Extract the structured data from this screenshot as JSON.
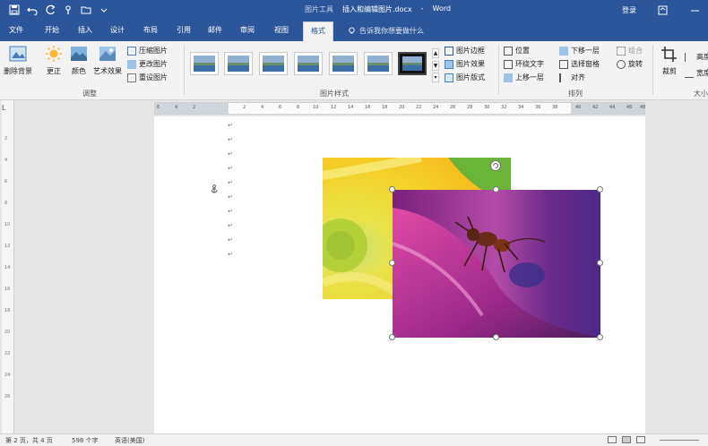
{
  "title": {
    "context": "图片工具",
    "document": "插入和编辑图片.docx",
    "app": "Word",
    "login": "登录"
  },
  "tabs": [
    "文件",
    "开始",
    "插入",
    "设计",
    "布局",
    "引用",
    "邮件",
    "审阅",
    "视图",
    "格式"
  ],
  "active_tab": "格式",
  "tell_me": "告诉我你想要做什么",
  "ribbon": {
    "adjust": {
      "label": "调整",
      "remove_bg": "删除背景",
      "corrections": "更正",
      "color": "颜色",
      "artistic": "艺术效果",
      "compress": "压缩图片",
      "change": "更改图片",
      "reset": "重设图片"
    },
    "styles": {
      "label": "图片样式",
      "border": "图片边框",
      "effects": "图片效果",
      "layout": "图片版式"
    },
    "arrange": {
      "label": "排列",
      "position": "位置",
      "wrap": "环绕文字",
      "forward": "上移一层",
      "backward": "下移一层",
      "selection": "选择窗格",
      "align": "对齐",
      "group": "组合",
      "rotate": "旋转"
    },
    "size": {
      "crop": "裁剪",
      "label": "大小",
      "height": "高度",
      "width": "宽度"
    }
  },
  "ruler": {
    "h_numbers": [
      "6",
      "4",
      "2",
      "",
      "2",
      "4",
      "6",
      "8",
      "10",
      "12",
      "14",
      "16",
      "18",
      "20",
      "22",
      "24",
      "26",
      "28",
      "30",
      "32",
      "34",
      "36",
      "38",
      "40",
      "42",
      "44",
      "46",
      "48"
    ],
    "corner": "L"
  },
  "status": {
    "page": "第 2 页，共 4 页",
    "words": "598 个字",
    "language": "英语(美国)"
  },
  "colors": {
    "titlebar": "#2b579a",
    "ribbon": "#f3f3f3",
    "page": "#ffffff"
  }
}
